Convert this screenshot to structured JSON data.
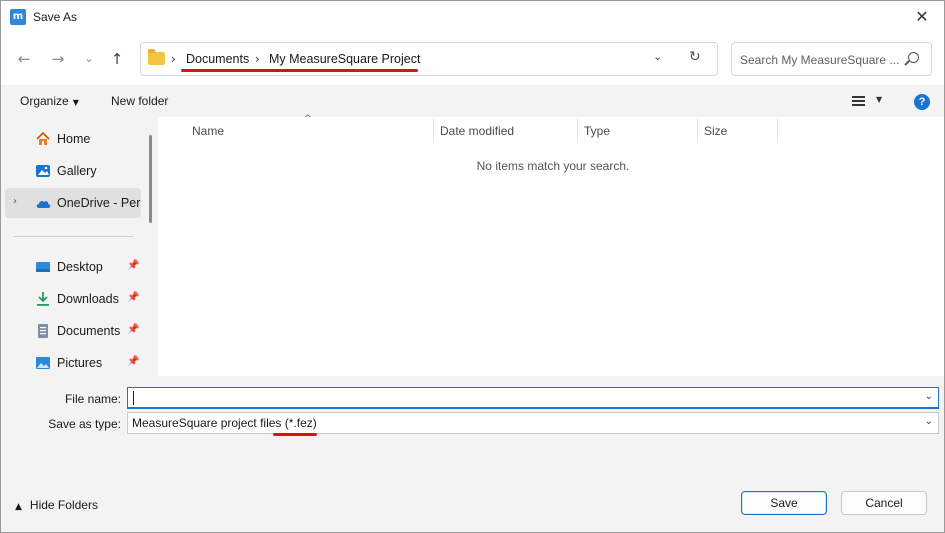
{
  "window": {
    "title": "Save As",
    "app_icon": "measuresquare-app-icon"
  },
  "nav": {
    "back_icon": "back-arrow-icon",
    "forward_icon": "forward-arrow-icon",
    "recent_icon": "chevron-down-icon",
    "up_icon": "up-arrow-icon",
    "breadcrumb": [
      "Documents",
      "My MeasureSquare Project"
    ],
    "search_placeholder": "Search My MeasureSquare ..."
  },
  "toolbar": {
    "organize": "Organize",
    "new_folder": "New folder"
  },
  "sidebar": {
    "items": [
      {
        "label": "Home",
        "icon": "home-icon"
      },
      {
        "label": "Gallery",
        "icon": "gallery-icon"
      },
      {
        "label": "OneDrive - Personal",
        "icon": "cloud-icon"
      },
      {
        "label": "Desktop",
        "icon": "desktop-icon"
      },
      {
        "label": "Downloads",
        "icon": "download-icon"
      },
      {
        "label": "Documents",
        "icon": "document-icon"
      },
      {
        "label": "Pictures",
        "icon": "pictures-icon"
      }
    ]
  },
  "columns": [
    "Name",
    "Date modified",
    "Type",
    "Size"
  ],
  "empty_message": "No items match your search.",
  "form": {
    "file_name_label": "File name:",
    "file_name_value": "",
    "save_type_label": "Save as type:",
    "save_type_value": "MeasureSquare project files (*.fez)"
  },
  "footer": {
    "hide_folders": "Hide Folders",
    "save": "Save",
    "cancel": "Cancel"
  },
  "colors": {
    "accent": "#1a73d1",
    "annotation": "#e01010",
    "folder": "#f4c542"
  }
}
